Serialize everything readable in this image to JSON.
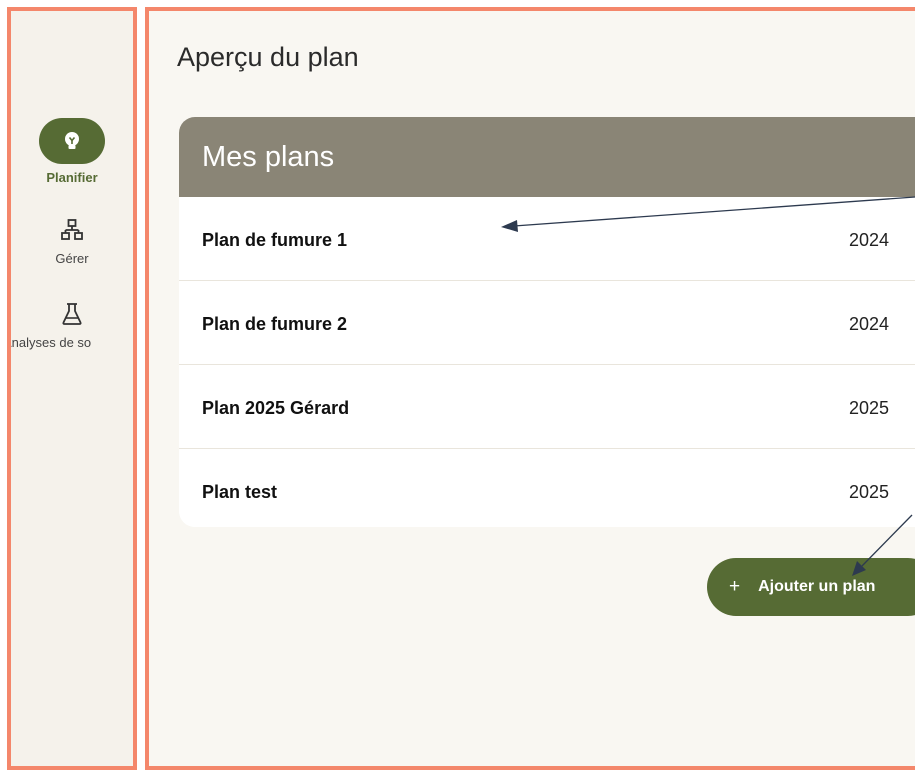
{
  "sidebar": {
    "items": [
      {
        "label": "Planifier",
        "icon": "lightbulb-icon",
        "active": true
      },
      {
        "label": "Gérer",
        "icon": "hierarchy-icon",
        "active": false
      },
      {
        "label": "Analyses de so",
        "icon": "flask-icon",
        "active": false
      }
    ]
  },
  "main": {
    "title": "Aperçu du plan",
    "plans_card": {
      "title": "Mes plans",
      "plans": [
        {
          "name": "Plan de fumure 1",
          "year": "2024"
        },
        {
          "name": "Plan de fumure 2",
          "year": "2024"
        },
        {
          "name": "Plan 2025 Gérard",
          "year": "2025"
        },
        {
          "name": "Plan test",
          "year": "2025"
        }
      ]
    },
    "add_button": {
      "icon": "+",
      "label": "Ajouter un plan"
    }
  },
  "colors": {
    "accent_green": "#566b34",
    "card_header": "#8a8576",
    "highlight_border": "#f4876b",
    "background": "#f9f7f2",
    "annotation_arrow": "#2d3a4f"
  }
}
